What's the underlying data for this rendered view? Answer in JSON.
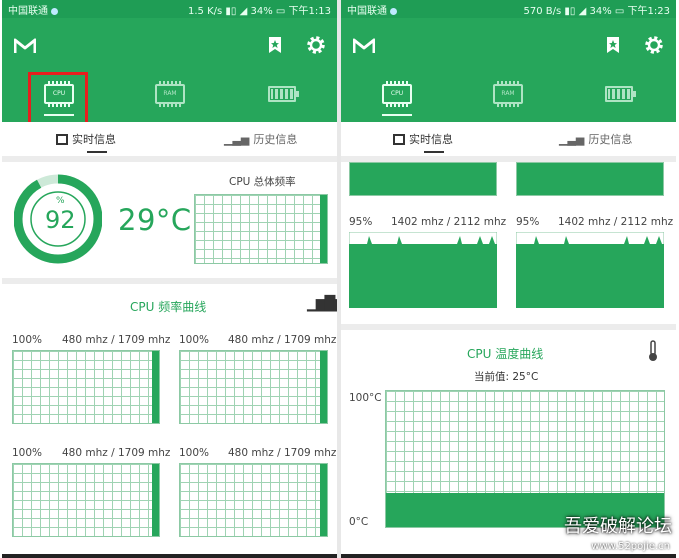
{
  "status_left": {
    "carrier": "中国联通",
    "speed": "1.5 K/s",
    "battery": "34%",
    "time": "下午1:13"
  },
  "status_right": {
    "carrier": "中国联通",
    "speed": "570 B/s",
    "battery": "34%",
    "time": "下午1:23"
  },
  "tabs": {
    "cpu": "CPU",
    "ram": "RAM"
  },
  "subtabs": {
    "realtime": "实时信息",
    "history": "历史信息"
  },
  "left": {
    "gauge": {
      "unit": "%",
      "value": "92",
      "fraction": 0.92
    },
    "temperature": "29°C",
    "total_freq_title": "CPU 总体频率",
    "freq_curve_title": "CPU 频率曲线",
    "cores": [
      {
        "pct": "100%",
        "freq": "480 mhz / 1709 mhz"
      },
      {
        "pct": "100%",
        "freq": "480 mhz / 1709 mhz"
      },
      {
        "pct": "100%",
        "freq": "480 mhz / 1709 mhz"
      },
      {
        "pct": "100%",
        "freq": "480 mhz / 1709 mhz"
      }
    ]
  },
  "right": {
    "cores": [
      {
        "pct": "95%",
        "freq": "1402 mhz / 2112 mhz"
      },
      {
        "pct": "95%",
        "freq": "1402 mhz / 2112 mhz"
      }
    ],
    "temp_title": "CPU 温度曲线",
    "current_label": "当前值: 25°C",
    "y_max": "100°C",
    "y_min": "0°C",
    "temp_level": 0.25
  },
  "watermark": {
    "text": "吾爱破解论坛",
    "url": "www.52pojie.cn"
  },
  "colors": {
    "primary": "#26a65b",
    "highlight": "#e61e1e"
  }
}
